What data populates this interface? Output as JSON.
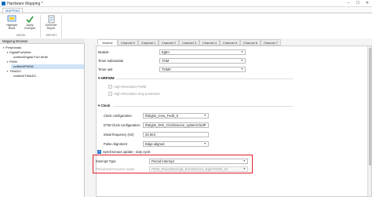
{
  "window": {
    "title": "Hardware Mapping *"
  },
  "ribbon": {
    "tab": "MAPPING",
    "buttons": [
      {
        "name": "highlight",
        "label1": "Highlight",
        "label2": "Block",
        "icon": "highlight-icon"
      },
      {
        "name": "apply",
        "label1": "Apply",
        "label2": "Changes",
        "icon": "apply-icon"
      },
      {
        "name": "generate-report",
        "label1": "Generate",
        "label2": "Report",
        "icon": "report-icon"
      }
    ],
    "groups": {
      "model": "MODEL",
      "report": "REPORT"
    }
  },
  "browser": {
    "header": "Mapping Browser",
    "tree": [
      {
        "label": "Peripherals",
        "caret": "▾"
      },
      {
        "label": "DigitalPortWrite",
        "caret": "▾"
      },
      {
        "label": "untitled/Digital Port Write",
        "caret": ""
      },
      {
        "label": "PWM",
        "caret": "▾"
      },
      {
        "label": "untitled/PWM1",
        "caret": ""
      },
      {
        "label": "TIMADC",
        "caret": "▾"
      },
      {
        "label": "untitled/TIMADC",
        "caret": ""
      }
    ]
  },
  "tabs": [
    "Module",
    "Channel 0",
    "Channel 1",
    "Channel 2",
    "Channel 3",
    "Channel 4",
    "Channel 5",
    "Channel 6",
    "Channel 7"
  ],
  "form": {
    "module": {
      "label": "Module",
      "value": "Egtm"
    },
    "timer_submodule": {
      "label": "Timer submodule",
      "value": "TOM"
    },
    "timer_unit": {
      "label": "Timer unit",
      "value": "TOM0"
    },
    "hrpwm": {
      "title": "HRPWM",
      "caret": "▾",
      "opt1": "High-Resolution PWM",
      "opt2": "High-Resolution duty parameter"
    },
    "clock": {
      "title": "Clock",
      "caret": "▾",
      "config": {
        "label": "Clock configuration:",
        "value": "IfxEgtm_Cmu_Fxclk_0"
      },
      "dtm": {
        "label": "DTM Clock configuration:",
        "value": "IfxEgtm_Dtm_ClockSource_systemClock"
      },
      "freq": {
        "label": "Initial frequency (Hz):",
        "value": "20.0e3"
      },
      "align": {
        "label": "Pulse Alignment",
        "value": "Edge aligned"
      }
    },
    "sync": {
      "label": "Synchronous update - duty cycle",
      "checked": true
    },
    "interrupt": {
      "label": "Interrupt Type",
      "value": "Period Interrupt"
    },
    "event": {
      "label": "Period Event source name",
      "value": "PWM_PeriodInterrupt_EventSource_EgtmTOM0_15"
    }
  },
  "colors": {
    "highlight": "#e0202a",
    "accent": "#2a78c8"
  }
}
